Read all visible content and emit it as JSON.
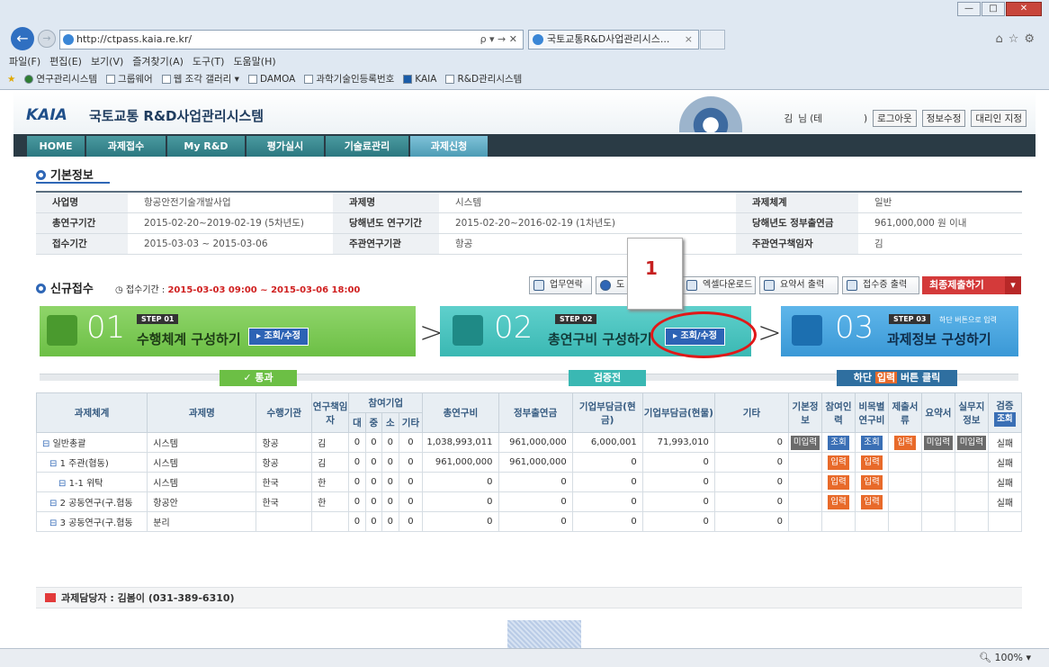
{
  "browser": {
    "url": "http://ctpass.kaia.re.kr/",
    "addr_tools": "ρ ▾ → ✕",
    "tab_title": "국토교통R&D사업관리시스...",
    "tab_close": "×",
    "menu": [
      "파일(F)",
      "편집(E)",
      "보기(V)",
      "즐겨찾기(A)",
      "도구(T)",
      "도움말(H)"
    ],
    "favorites": [
      "연구관리시스템",
      "그룹웨어",
      "웹 조각 갤러리 ▾",
      "DAMOA",
      "과학기술인등록번호",
      "KAIA",
      "R&D관리시스템"
    ],
    "window_buttons": [
      "—",
      "□",
      "✕"
    ],
    "right_icons": "⌂☆⚙",
    "zoom": "100%"
  },
  "header": {
    "logo": "KAIA",
    "system_title": "국토교통 R&D사업관리시스템",
    "user_name": "김",
    "user_suffix": "님 (테",
    "user_close": ")",
    "logout": "로그아웃",
    "edit_info": "정보수정",
    "proxy": "대리인 지정"
  },
  "nav": [
    "HOME",
    "과제접수",
    "My R&D",
    "평가실시",
    "기술료관리",
    "과제신청"
  ],
  "basic": {
    "title": "기본정보",
    "rows": [
      [
        "사업명",
        "항공안전기술개발사업",
        "과제명",
        "시스템",
        "과제체계",
        "일반"
      ],
      [
        "총연구기간",
        "2015-02-20~2019-02-19 (5차년도)",
        "당해년도 연구기간",
        "2015-02-20~2016-02-19 (1차년도)",
        "당해년도 정부출연금",
        "961,000,000 원 이내"
      ],
      [
        "접수기간",
        "2015-03-03 ~ 2015-03-06",
        "주관연구기관",
        "항공",
        "주관연구책임자",
        "김"
      ]
    ]
  },
  "newreg": {
    "title": "신규접수",
    "period_label": "접수기간 :",
    "period_value": "2015-03-03 09:00 ~ 2015-03-06 18:00",
    "buttons": [
      "업무연락",
      "도",
      "엑셀다운로드",
      "요약서 출력",
      "접수증 출력"
    ],
    "final_button": "최종제출하기"
  },
  "steps": [
    {
      "tag": "STEP 01",
      "num": "01",
      "title": "수행체계 구성하기",
      "button": "조회/수정",
      "status": "통과"
    },
    {
      "tag": "STEP 02",
      "num": "02",
      "title": "총연구비 구성하기",
      "button": "조회/수정",
      "status": "검증전"
    },
    {
      "tag": "STEP 03",
      "num": "03",
      "title": "과제정보 구성하기",
      "note": "하단 버튼으로 입력",
      "status_pre": "하단",
      "status_hl": "입력",
      "status_post": "버튼 클릭"
    }
  ],
  "grid": {
    "headers": {
      "system": "과제체계",
      "name": "과제명",
      "org": "수행기관",
      "pi": "연구책임자",
      "company": "참여기업",
      "big": "대",
      "mid": "중",
      "small": "소",
      "etc": "기타",
      "total": "총연구비",
      "gov": "정부출연금",
      "cash": "기업부담금(현금)",
      "inkind": "기업부담금(현물)",
      "other": "기타",
      "basic": "기본정보",
      "people": "참여인력",
      "cost": "비목별연구비",
      "submit": "제출서류",
      "summary": "요약서",
      "practical": "실무지정보",
      "verify": "검증",
      "verify_btn": "조회"
    },
    "rows": [
      {
        "system": "일반총괄",
        "name": "시스템",
        "org": "항공",
        "pi": "김",
        "n": [
          "0",
          "0",
          "0",
          "0"
        ],
        "total": "1,038,993,011",
        "gov": "961,000,000",
        "cash": "6,000,001",
        "inkind": "71,993,010",
        "other": "0",
        "btns": [
          "미입력",
          "조회",
          "조회",
          "입력",
          "미입력",
          "미입력"
        ],
        "result": "실패"
      },
      {
        "system": "1 주관(협동)",
        "name": "시스템",
        "org": "항공",
        "pi": "김",
        "n": [
          "0",
          "0",
          "0",
          "0"
        ],
        "total": "961,000,000",
        "gov": "961,000,000",
        "cash": "0",
        "inkind": "0",
        "other": "0",
        "btns": [
          "",
          "입력",
          "입력",
          "",
          "",
          ""
        ],
        "result": "실패"
      },
      {
        "system": "1-1 위탁",
        "name": "시스템",
        "org": "한국",
        "pi": "한",
        "n": [
          "0",
          "0",
          "0",
          "0"
        ],
        "total": "0",
        "gov": "0",
        "cash": "0",
        "inkind": "0",
        "other": "0",
        "btns": [
          "",
          "입력",
          "입력",
          "",
          "",
          ""
        ],
        "result": "실패"
      },
      {
        "system": "2 공동연구(구.협동",
        "name": "항공안",
        "org": "한국",
        "pi": "한",
        "n": [
          "0",
          "0",
          "0",
          "0"
        ],
        "total": "0",
        "gov": "0",
        "cash": "0",
        "inkind": "0",
        "other": "0",
        "btns": [
          "",
          "입력",
          "입력",
          "",
          "",
          ""
        ],
        "result": "실패"
      },
      {
        "system": "3 공동연구(구.협동",
        "name": "분리",
        "org": "",
        "pi": "",
        "n": [
          "0",
          "0",
          "0",
          "0"
        ],
        "total": "0",
        "gov": "0",
        "cash": "0",
        "inkind": "0",
        "other": "0",
        "btns": [
          "",
          "",
          "",
          "",
          "",
          ""
        ],
        "result": ""
      }
    ]
  },
  "contact": "과제담당자 : 김봄이 (031-389-6310)",
  "annotation": "1"
}
